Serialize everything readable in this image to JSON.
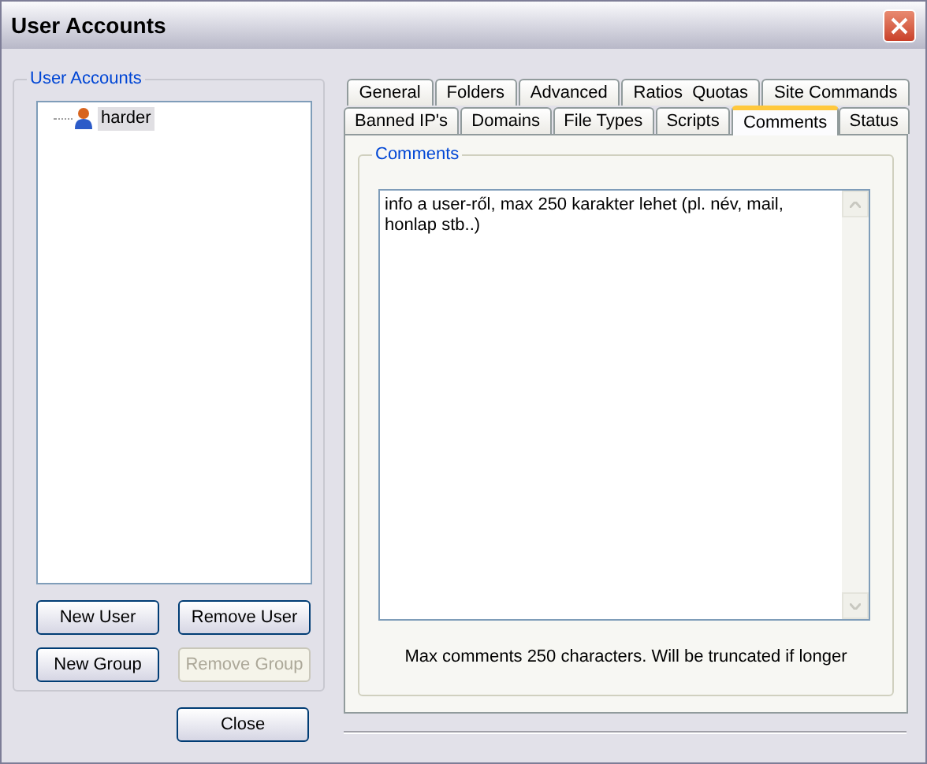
{
  "window": {
    "title": "User Accounts"
  },
  "accounts": {
    "title": "User Accounts",
    "items": [
      {
        "label": "harder",
        "selected": true
      }
    ]
  },
  "account_buttons": [
    {
      "label": "New User",
      "disabled": false
    },
    {
      "label": "Remove User",
      "disabled": false
    },
    {
      "label": "New Group",
      "disabled": false
    },
    {
      "label": "Remove Group",
      "disabled": true
    }
  ],
  "close_button": {
    "label": "Close"
  },
  "tab_rows": [
    [
      {
        "label": "General",
        "selected": false
      },
      {
        "label": "Folders",
        "selected": false
      },
      {
        "label": "Advanced",
        "selected": false
      },
      {
        "label": "Ratios  Quotas",
        "selected": false
      },
      {
        "label": "Site Commands",
        "selected": false
      }
    ],
    [
      {
        "label": "Banned IP's",
        "selected": false
      },
      {
        "label": "Domains",
        "selected": false
      },
      {
        "label": "File Types",
        "selected": false
      },
      {
        "label": "Scripts",
        "selected": false
      },
      {
        "label": "Comments",
        "selected": true
      },
      {
        "label": "Status",
        "selected": false
      }
    ]
  ],
  "comments": {
    "title": "Comments",
    "value": "info a user-ről, max 250 karakter lehet (pl. név, mail, honlap stb..)",
    "note": "Max comments 250 characters. Will be truncated if longer"
  }
}
